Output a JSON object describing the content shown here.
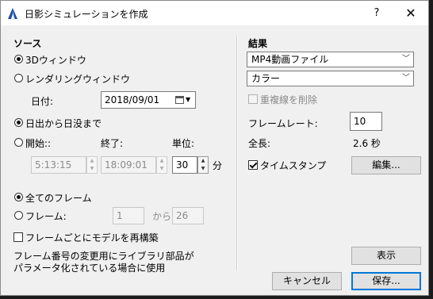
{
  "window": {
    "title": "日影シミュレーションを作成",
    "help": "?",
    "close": "✕"
  },
  "source": {
    "heading": "ソース",
    "view_3d": "3Dウィンドウ",
    "rendering_window": "レンダリングウィンドウ",
    "date_label": "日付:",
    "date_value": "2018/09/01",
    "sunrise_sunset": "日出から日没まで",
    "start_label": "開始::",
    "end_label": "終了:",
    "unit_label": "単位:",
    "start_value": "5:13:15",
    "end_value": "18:09:01",
    "unit_value": "30",
    "unit_suffix": "分",
    "all_frames": "全てのフレーム",
    "frames_label": "フレーム:",
    "frame_from": "1",
    "from_label": "から",
    "frame_to": "26",
    "rebuild_label": "フレームごとにモデルを再構築",
    "note": "フレーム番号の変更用にライブラリ部品が\nパラメータ化されている場合に使用"
  },
  "result": {
    "heading": "結果",
    "format_value": "MP4動画ファイル",
    "color_value": "カラー",
    "remove_dup_lines": "重複線を削除",
    "frame_rate_label": "フレームレート:",
    "frame_rate_value": "10",
    "total_label": "全長:",
    "total_value": "2.6 秒",
    "timestamp_label": "タイムスタンプ",
    "edit_button": "編集...",
    "show_button": "表示"
  },
  "footer": {
    "cancel": "キャンセル",
    "save": "保存..."
  },
  "colors": {
    "accent": "#0078d7",
    "dialog_bg": "#f0f0f0"
  }
}
